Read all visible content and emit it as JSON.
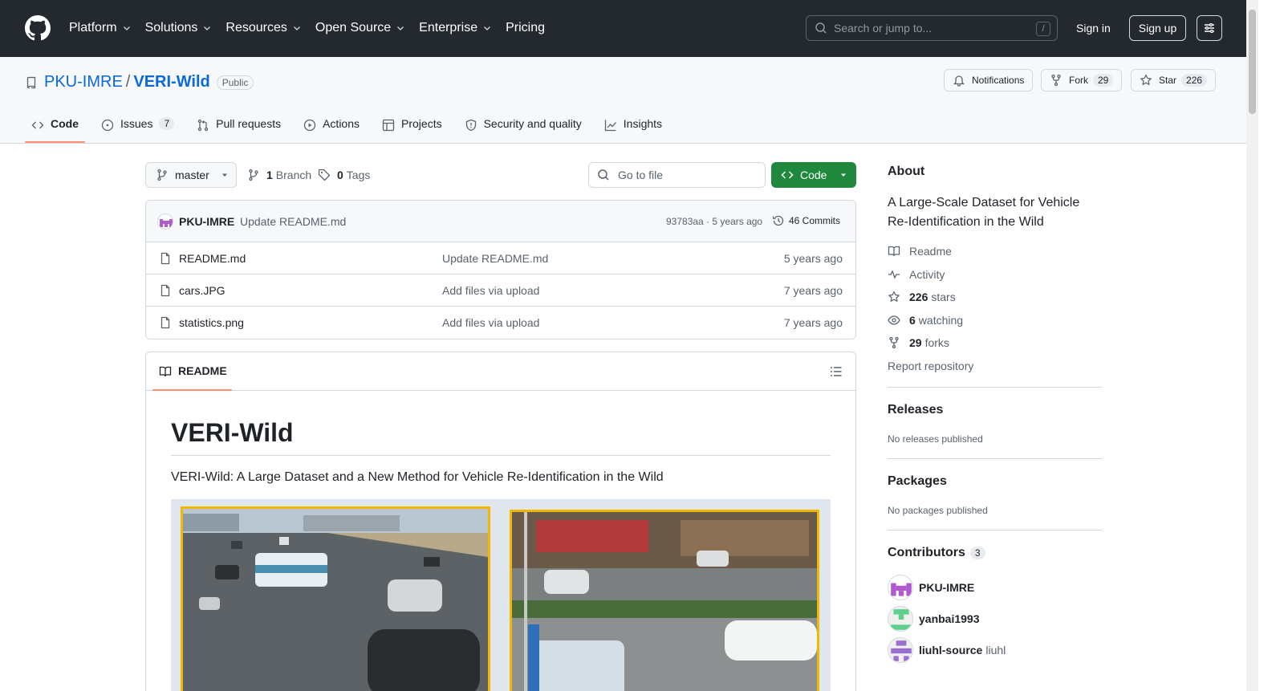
{
  "header": {
    "nav": [
      "Platform",
      "Solutions",
      "Resources",
      "Open Source",
      "Enterprise",
      "Pricing"
    ],
    "search_placeholder": "Search or jump to...",
    "search_shortcut": "/",
    "signin": "Sign in",
    "signup": "Sign up"
  },
  "repo": {
    "owner": "PKU-IMRE",
    "separator": "/",
    "name": "VERI-Wild",
    "visibility": "Public",
    "notifications": "Notifications",
    "fork_label": "Fork",
    "fork_count": "29",
    "star_label": "Star",
    "star_count": "226"
  },
  "tabs": [
    {
      "label": "Code",
      "active": true
    },
    {
      "label": "Issues",
      "count": "7"
    },
    {
      "label": "Pull requests"
    },
    {
      "label": "Actions"
    },
    {
      "label": "Projects"
    },
    {
      "label": "Security and quality"
    },
    {
      "label": "Insights"
    }
  ],
  "toolbar": {
    "branch": "master",
    "branch_count": "1",
    "branch_label": "Branch",
    "tag_count": "0",
    "tag_label": "Tags",
    "goto_placeholder": "Go to file",
    "code_button": "Code"
  },
  "commit": {
    "author": "PKU-IMRE",
    "message": "Update README.md",
    "hash_age": "93783aa · 5 years ago",
    "count": "46 Commits"
  },
  "files": [
    {
      "name": "README.md",
      "message": "Update README.md",
      "age": "5 years ago"
    },
    {
      "name": "cars.JPG",
      "message": "Add files via upload",
      "age": "7 years ago"
    },
    {
      "name": "statistics.png",
      "message": "Add files via upload",
      "age": "7 years ago"
    }
  ],
  "readme": {
    "tab": "README",
    "title": "VERI-Wild",
    "paragraph": "VERI-Wild: A Large Dataset and a New Method for Vehicle Re-Identification in the Wild"
  },
  "sidebar": {
    "about_title": "About",
    "description": "A Large-Scale Dataset for Vehicle Re-Identification in the Wild",
    "readme": "Readme",
    "activity": "Activity",
    "stars_count": "226",
    "stars_label": "stars",
    "watching_count": "6",
    "watching_label": "watching",
    "forks_count": "29",
    "forks_label": "forks",
    "report": "Report repository",
    "releases_title": "Releases",
    "releases_text": "No releases published",
    "packages_title": "Packages",
    "packages_text": "No packages published",
    "contributors_title": "Contributors",
    "contributors_count": "3",
    "contributors": [
      {
        "login": "PKU-IMRE",
        "name": ""
      },
      {
        "login": "yanbai1993",
        "name": ""
      },
      {
        "login": "liuhl-source",
        "name": "liuhl"
      }
    ]
  },
  "colors": {
    "header_bg": "#24292f",
    "link": "#0969da",
    "primary_button": "#1f883d",
    "tab_underline": "#fd8c73"
  }
}
